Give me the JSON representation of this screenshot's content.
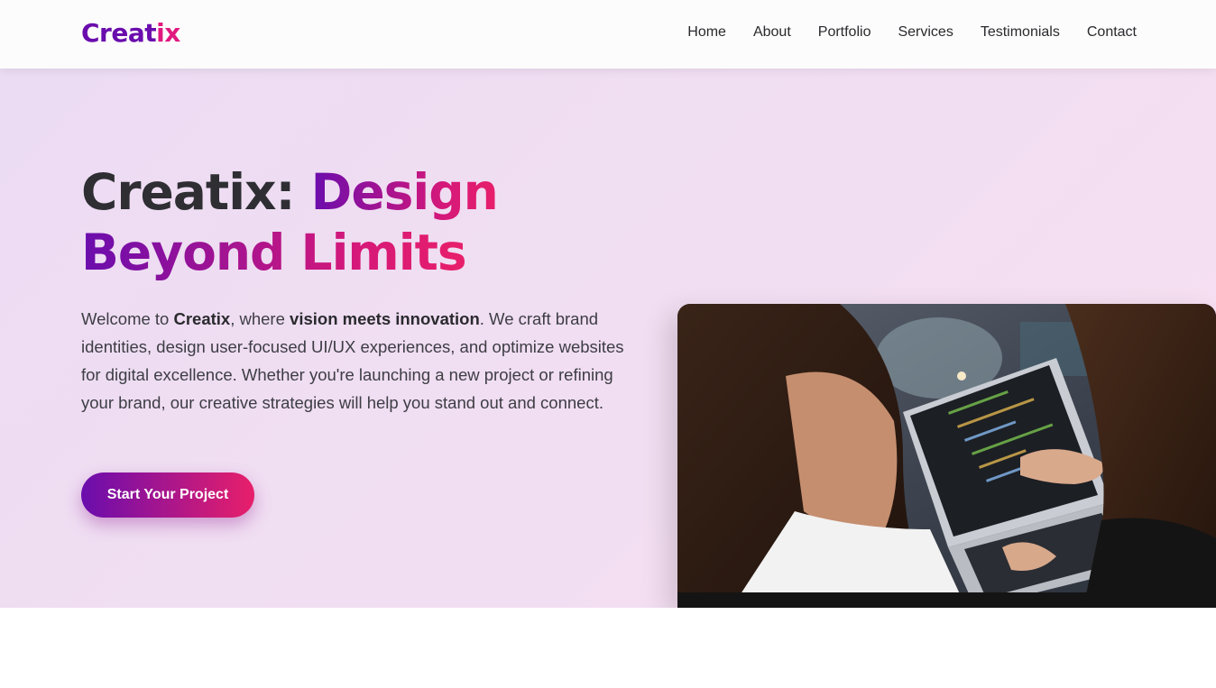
{
  "brand": {
    "part1": "Creat",
    "part2": "ix"
  },
  "nav": {
    "items": [
      "Home",
      "About",
      "Portfolio",
      "Services",
      "Testimonials",
      "Contact"
    ]
  },
  "hero": {
    "title_prefix": "Creatix: ",
    "title_accent_1": "Design",
    "title_accent_2": "Beyond Limits",
    "desc_1": "Welcome to ",
    "desc_brand": "Creatix",
    "desc_2": ", where ",
    "desc_bold": "vision meets innovation",
    "desc_3": ". We craft brand identities, design user-focused UI/UX experiences, and optimize websites for digital excellence. Whether you're launching a new project or refining your brand, our creative strategies will help you stand out and connect.",
    "cta_label": "Start Your Project"
  },
  "colors": {
    "primary": "#6a0dad",
    "accent": "#e81f6a",
    "text": "#2e2e33"
  }
}
